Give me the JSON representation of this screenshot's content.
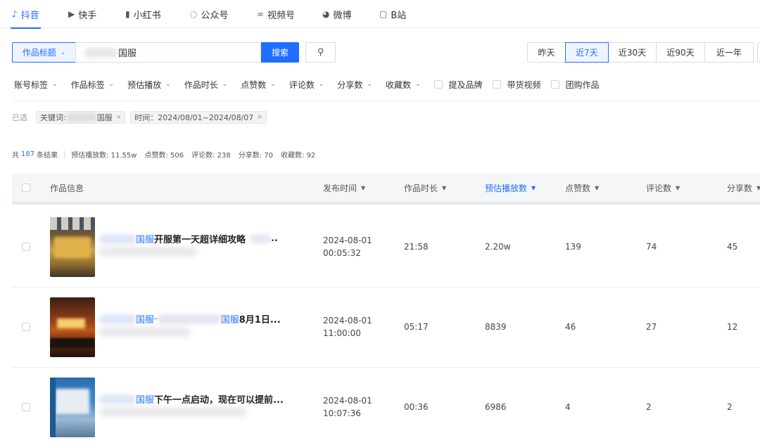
{
  "platform_tabs": [
    {
      "label": "抖音",
      "icon": "douyin-icon",
      "active": true
    },
    {
      "label": "快手",
      "icon": "kuaishou-icon",
      "active": false
    },
    {
      "label": "小红书",
      "icon": "xiaohongshu-icon",
      "active": false
    },
    {
      "label": "公众号",
      "icon": "wechat-official-icon",
      "active": false
    },
    {
      "label": "视频号",
      "icon": "channels-icon",
      "active": false
    },
    {
      "label": "微博",
      "icon": "weibo-icon",
      "active": false
    },
    {
      "label": "B站",
      "icon": "bilibili-icon",
      "active": false
    }
  ],
  "search": {
    "field": "作品标题",
    "query_visible": "国服",
    "button": "搜索"
  },
  "date_ranges": [
    {
      "label": "昨天",
      "active": false
    },
    {
      "label": "近7天",
      "active": true
    },
    {
      "label": "近30天",
      "active": false
    },
    {
      "label": "近90天",
      "active": false
    },
    {
      "label": "近一年",
      "active": false
    }
  ],
  "filters": [
    "账号标签",
    "作品标签",
    "预估播放",
    "作品时长",
    "点赞数",
    "评论数",
    "分享数",
    "收藏数"
  ],
  "checkbox_filters": [
    "提及品牌",
    "带货视频",
    "团购作品"
  ],
  "selected": {
    "label": "已选",
    "keyword_prefix": "关键词:",
    "keyword_visible": "国服",
    "time": "时间：2024/08/01~2024/08/07"
  },
  "summary": {
    "total_prefix": "共",
    "total": "187",
    "total_suffix": "条结果",
    "plays": "预估播放数: 11.55w",
    "likes": "点赞数: 506",
    "comments": "评论数: 238",
    "shares": "分享数: 70",
    "favorites": "收藏数: 92"
  },
  "columns": {
    "info": "作品信息",
    "publish": "发布时间",
    "duration": "作品时长",
    "plays": "预估播放数",
    "likes": "点赞数",
    "comments": "评论数",
    "shares": "分享数"
  },
  "rows": [
    {
      "title_kw": "国服",
      "title_rest": "开服第一天超详细攻略",
      "date": "2024-08-01",
      "time": "00:05:32",
      "duration": "21:58",
      "plays": "2.20w",
      "likes": "139",
      "comments": "74",
      "shares": "45"
    },
    {
      "title_kw": "国服",
      "title_mid": "-",
      "title_kw2": "国服",
      "title_rest": "8月1日...",
      "date": "2024-08-01",
      "time": "11:00:00",
      "duration": "05:17",
      "plays": "8839",
      "likes": "46",
      "comments": "27",
      "shares": "12"
    },
    {
      "title_kw": "国服",
      "title_rest": "下午一点启动，现在可以提前...",
      "date": "2024-08-01",
      "time": "10:07:36",
      "duration": "00:36",
      "plays": "6986",
      "likes": "4",
      "comments": "2",
      "shares": "2"
    }
  ],
  "colors": {
    "accent": "#1f6fff"
  }
}
